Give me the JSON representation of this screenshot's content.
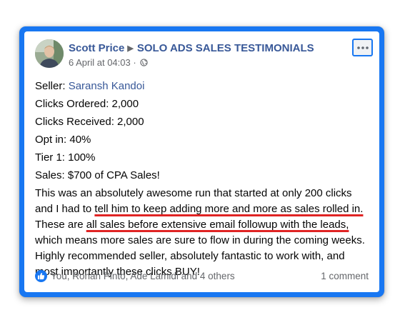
{
  "post": {
    "author": "Scott Price",
    "group": "SOLO ADS SALES TESTIMONIALS",
    "timestamp": "6 April at 04:03 ·",
    "more_icon": "more-options-icon",
    "audience_icon": "globe-icon"
  },
  "body": {
    "seller_label": "Seller: ",
    "seller_name": "Saransh Kandoi",
    "clicks_ordered": "Clicks Ordered: 2,000",
    "clicks_received": "Clicks Received: 2,000",
    "opt_in": "Opt in: 40%",
    "tier1": "Tier 1: 100%",
    "sales": "Sales: $700 of CPA Sales!",
    "story_part1": "This was an absolutely awesome run that started at only 200 clicks and I had to ",
    "story_highlight1": "tell him to keep adding more and more as sales rolled in.",
    "story_part2": " These are ",
    "story_highlight2": "all sales before extensive email followup with the leads,",
    "story_part3": " which means more sales are sure to flow in during the coming weeks. Highly recommended seller, absolutely fantastic to work with, and most importantly these clicks BUY!"
  },
  "footer": {
    "reactions": "You, Rohan Pinto, Ade Lamidi and 4 others",
    "comments": "1 comment"
  },
  "colors": {
    "accent": "#1877f2",
    "link": "#385898",
    "highlight": "#e02424"
  }
}
